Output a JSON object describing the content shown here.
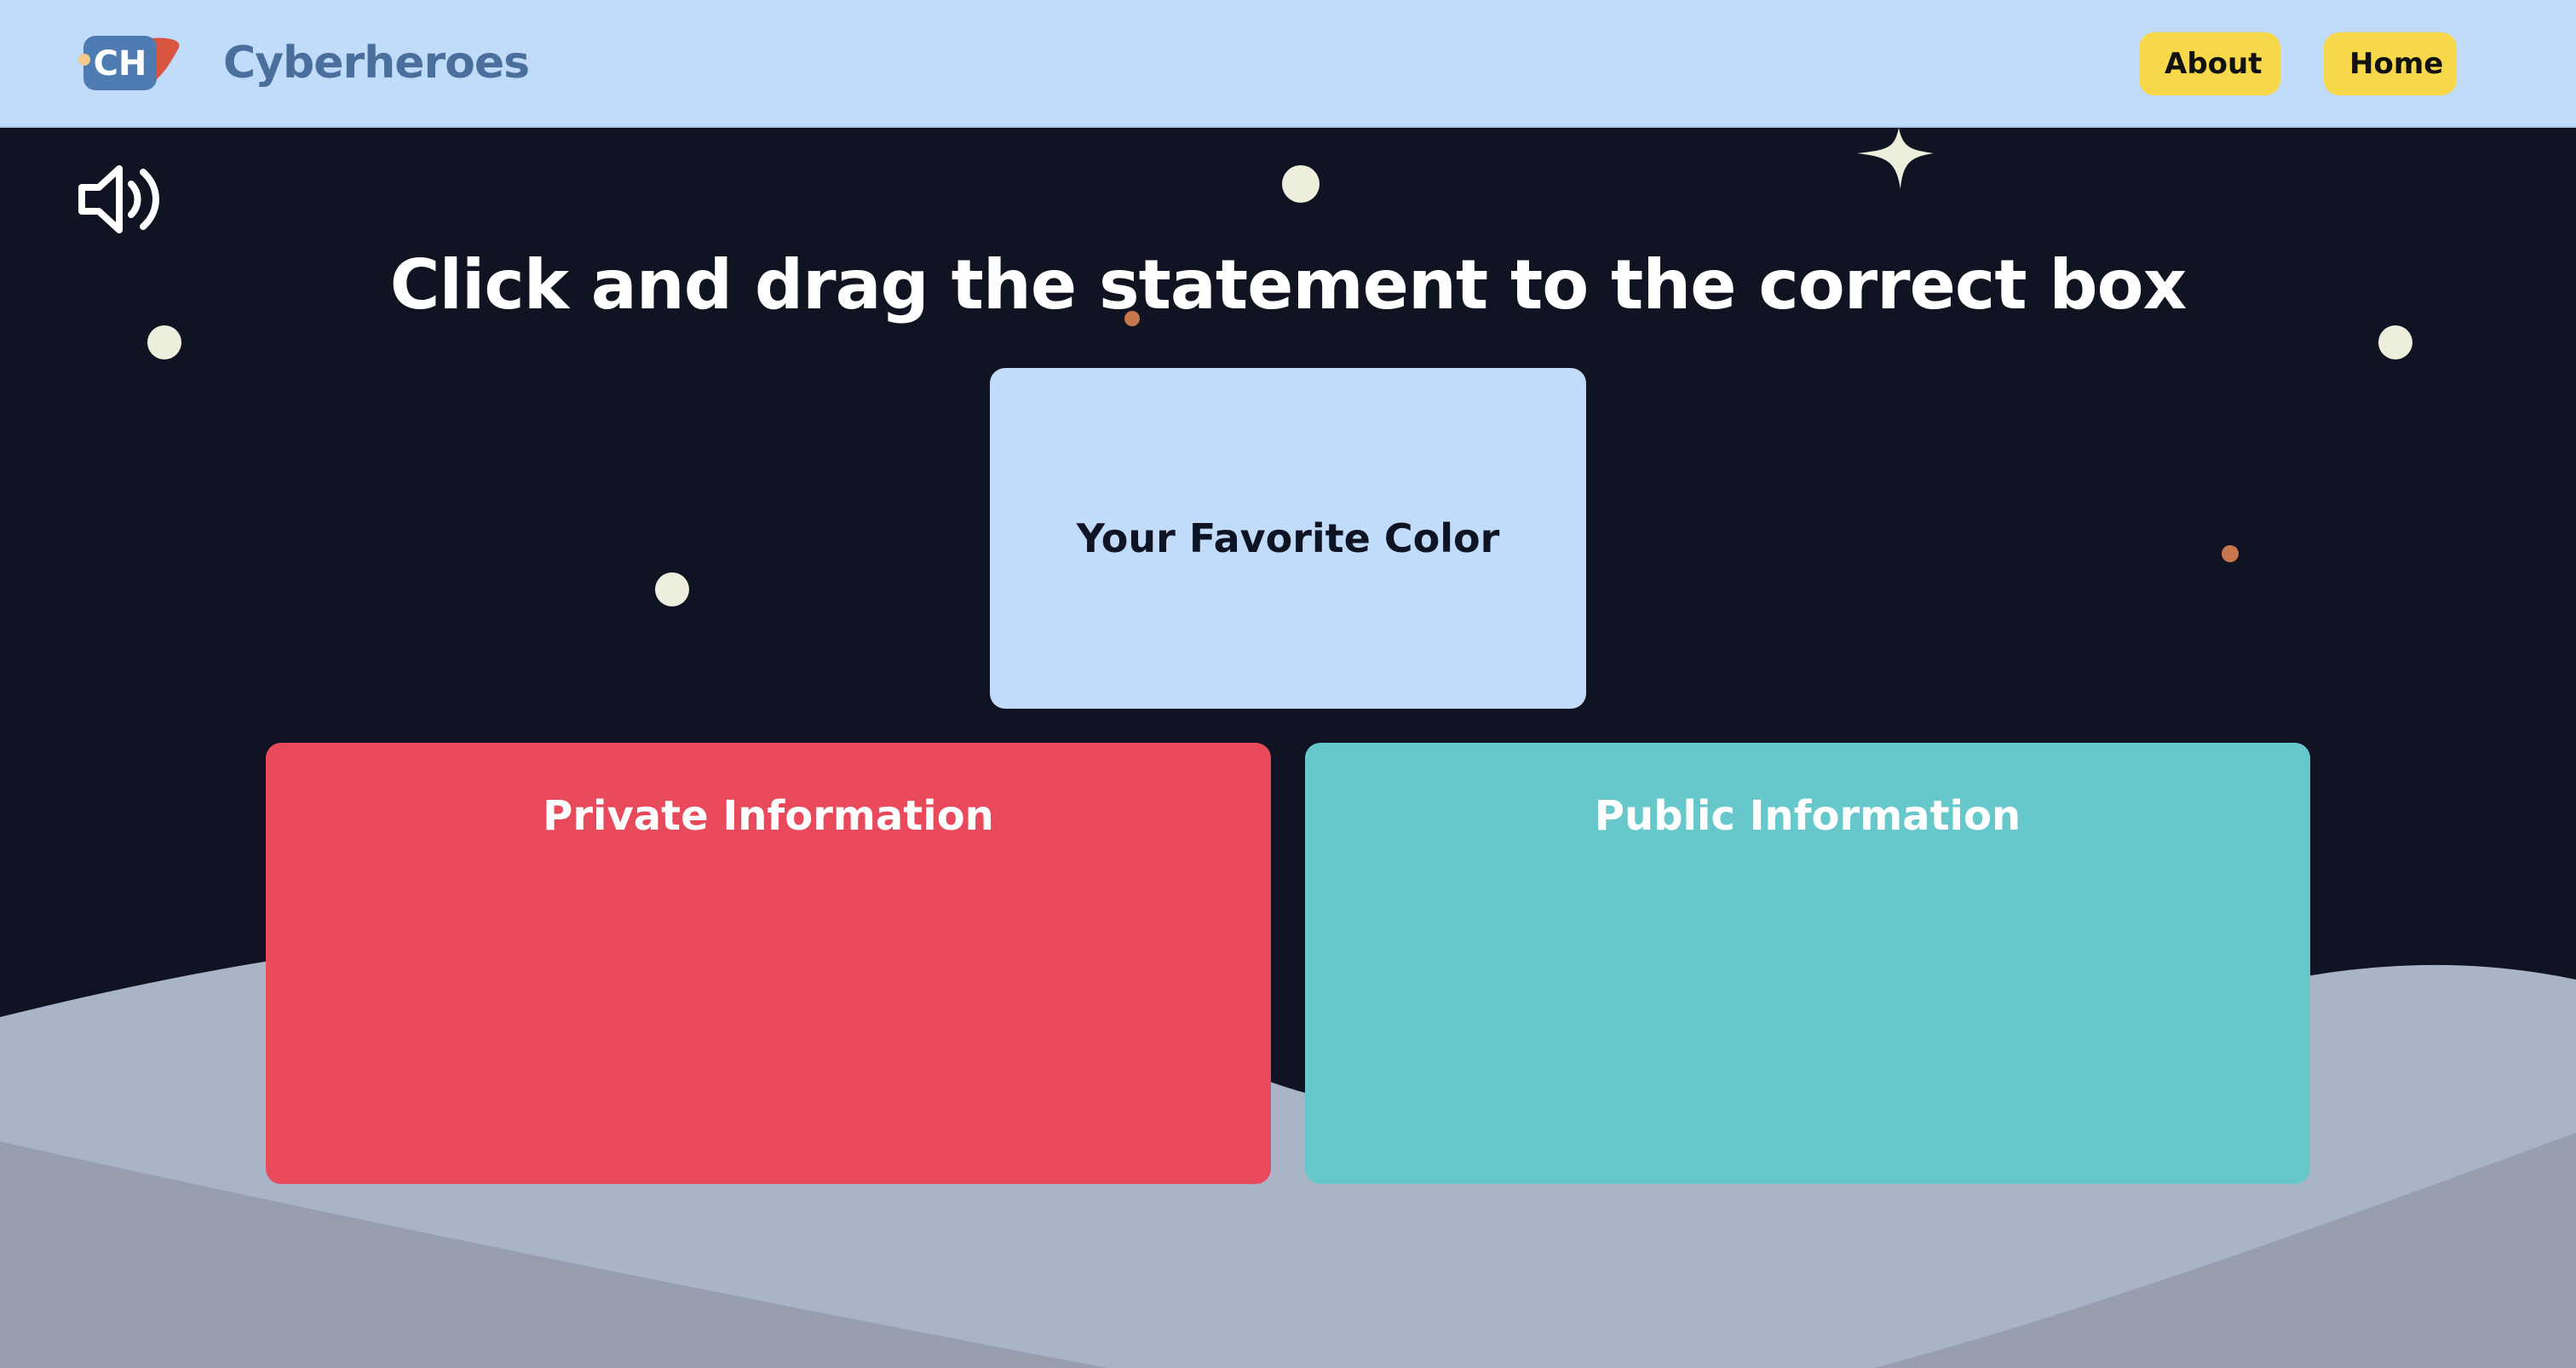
{
  "navbar": {
    "brand": "Cyberheroes",
    "logo_text": "CH",
    "about_label": "About",
    "home_label": "Home",
    "background_color": "#c0dcfa",
    "button_color": "#f7d84a"
  },
  "game": {
    "sound_icon": "speaker-icon",
    "instruction": "Click and drag the statement to the correct box",
    "statement": "Your Favorite Color",
    "boxes": [
      {
        "label": "Private Information",
        "color": "#e94a5b"
      },
      {
        "label": "Public Information",
        "color": "#67c8cb"
      }
    ],
    "background_color": "#101422"
  }
}
